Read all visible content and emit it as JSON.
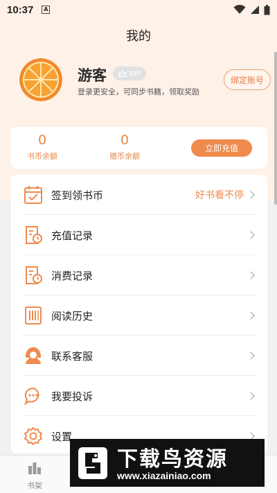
{
  "status_bar": {
    "time": "10:37",
    "app_indicator": "A"
  },
  "header": {
    "title": "我的"
  },
  "profile": {
    "username": "游客",
    "vip_label": "VIP",
    "subtitle": "登录更安全，可同步书籍，领取奖励",
    "bind_label": "绑定账号"
  },
  "balance": {
    "book_coins": {
      "value": "0",
      "label": "书币余额"
    },
    "gift_coins": {
      "value": "0",
      "label": "赠币余额"
    },
    "recharge_label": "立即充值"
  },
  "menu": {
    "items": [
      {
        "label": "签到领书币",
        "extra": "好书看不停",
        "icon": "calendar-check-icon"
      },
      {
        "label": "充值记录",
        "icon": "receipt-clock-icon"
      },
      {
        "label": "消费记录",
        "icon": "receipt-clock-icon"
      },
      {
        "label": "阅读历史",
        "icon": "book-history-icon"
      },
      {
        "label": "联系客服",
        "icon": "customer-service-icon"
      },
      {
        "label": "我要投诉",
        "icon": "chat-bubble-icon"
      },
      {
        "label": "设置",
        "icon": "gear-icon"
      }
    ]
  },
  "tab_bar": {
    "tabs": [
      {
        "label": "书架",
        "icon": "bookshelf-icon"
      }
    ]
  },
  "watermark": {
    "title": "下载鸟资源",
    "url": "www.xiazainiao.com"
  },
  "colors": {
    "accent": "#ef8b4d",
    "header_bg": "#fdf1e8",
    "page_bg": "#f1f1f1"
  }
}
